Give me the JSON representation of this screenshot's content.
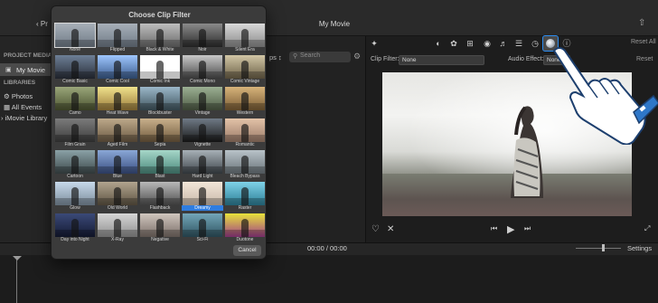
{
  "window": {
    "title": "My Movie",
    "back_label": "Pr",
    "share_icon": "share-icon"
  },
  "sidebar": {
    "project_media_header": "PROJECT MEDIA",
    "project_item": "My Movie",
    "libraries_header": "LIBRARIES",
    "items": [
      "Photos",
      "All Events",
      "iMovie Library"
    ]
  },
  "browser": {
    "apps_label": "ps",
    "search_placeholder": "Search"
  },
  "viewer": {
    "reset_all": "Reset All",
    "clip_filter_label": "Clip Filter:",
    "clip_filter_value": "None",
    "audio_effect_label": "Audio Effect:",
    "audio_effect_value": "None",
    "reset": "Reset",
    "toolbar_icons": [
      "wand-icon",
      "color-balance-icon",
      "color-palette-icon",
      "crop-icon",
      "camera-icon",
      "volume-icon",
      "equalizer-icon",
      "speed-icon",
      "clip-filter-icon",
      "info-icon"
    ]
  },
  "timeline": {
    "timecode": "00:00 / 00:00",
    "settings": "Settings"
  },
  "dialog": {
    "title": "Choose Clip Filter",
    "cancel": "Cancel",
    "selected": "None",
    "highlighted": "Dreamy",
    "filters": [
      "None",
      "Flipped",
      "Black & White",
      "Noir",
      "Silent Era",
      "Comic Basic",
      "Comic Cool",
      "Comic Ink",
      "Comic Mono",
      "Comic Vintage",
      "Camo",
      "Heat Wave",
      "Blockbuster",
      "Vintage",
      "Western",
      "Film Grain",
      "Aged Film",
      "Sepia",
      "Vignette",
      "Romantic",
      "Cartoon",
      "Blue",
      "Blast",
      "Hard Light",
      "Bleach Bypass",
      "Glow",
      "Old World",
      "Flashback",
      "Dreamy",
      "Raster",
      "Day into Night",
      "X-Ray",
      "Negative",
      "Sci-Fi",
      "Duotone"
    ]
  }
}
